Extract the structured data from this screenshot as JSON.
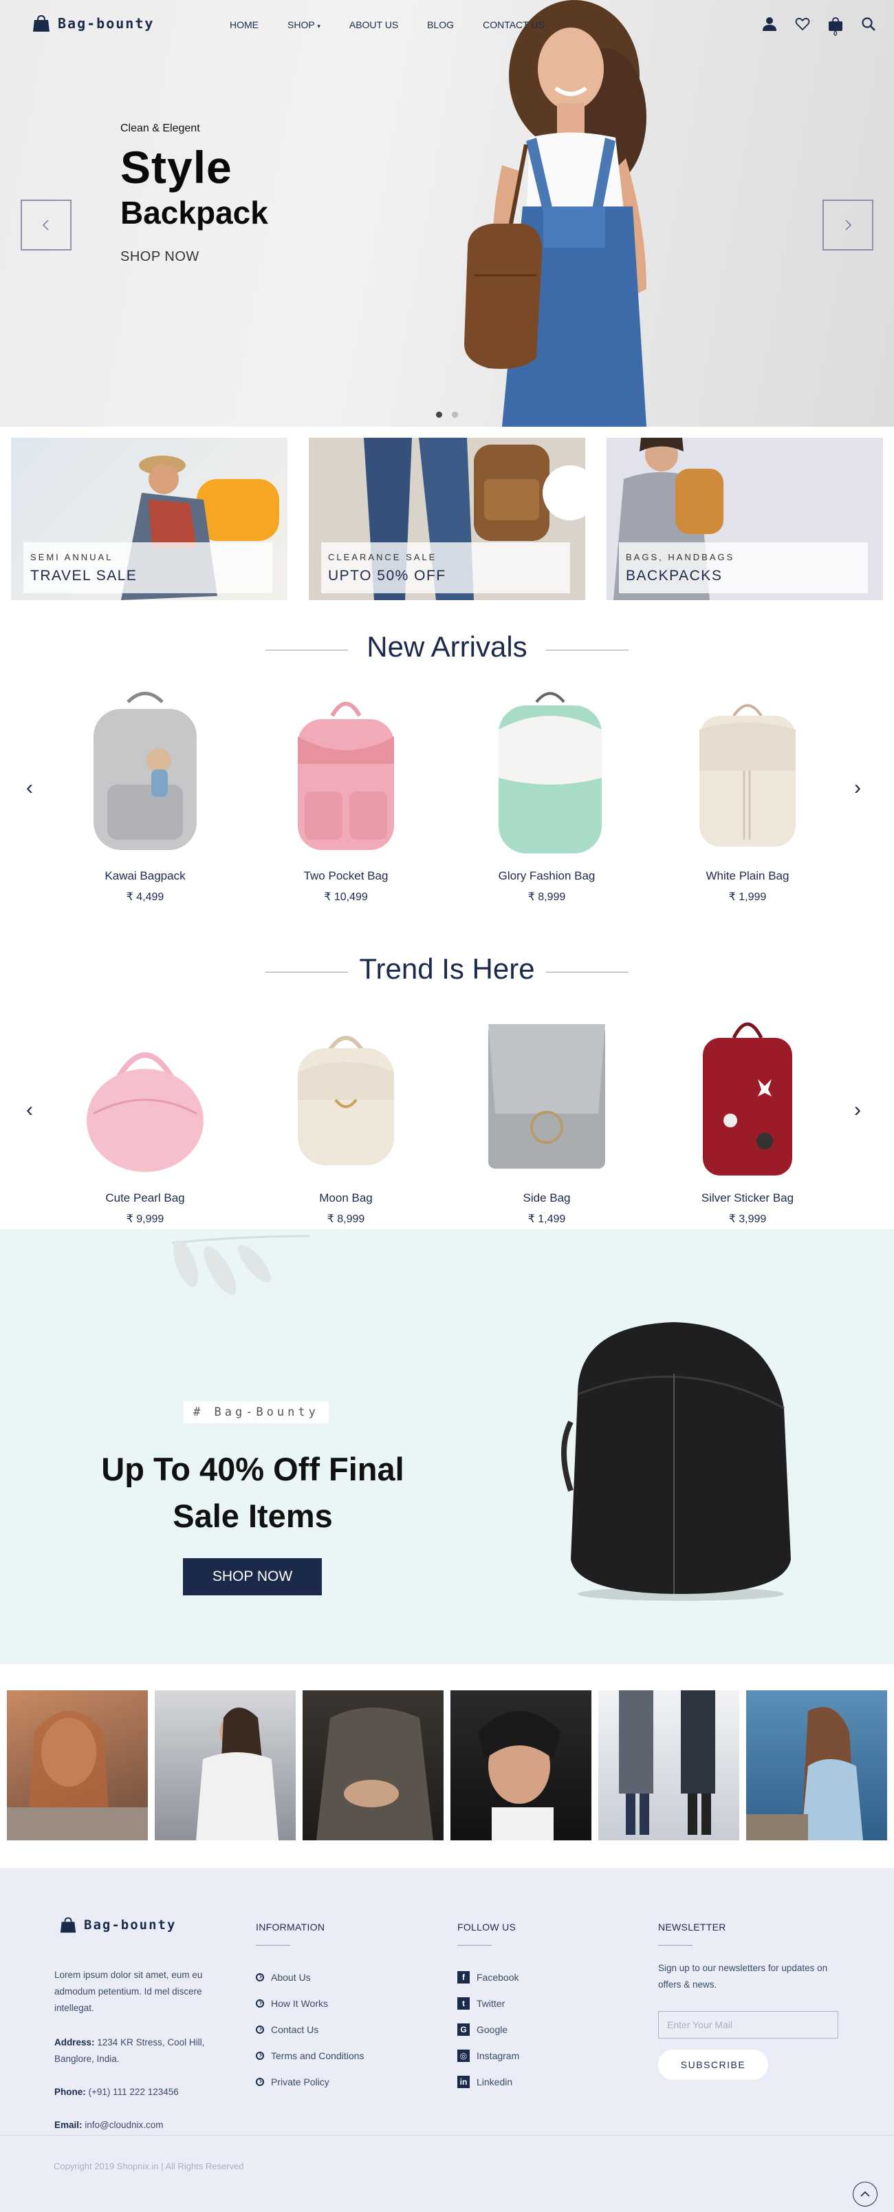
{
  "header": {
    "brand": "Bag-bounty",
    "nav": [
      "HOME",
      "SHOP",
      "ABOUT US",
      "BLOG",
      "CONTACT US"
    ],
    "cart_count": "0"
  },
  "hero": {
    "tagline": "Clean & Elegent",
    "title_line1": "Style",
    "title_line2": "Backpack",
    "cta": "SHOP NOW",
    "slide_index": 1,
    "slide_total": 2
  },
  "promos": [
    {
      "small": "SEMI ANNUAL",
      "big": "TRAVEL SALE"
    },
    {
      "small": "CLEARANCE SALE",
      "big": "UPTO 50% OFF"
    },
    {
      "small": "BAGS, HANDBAGS",
      "big": "BACKPACKS"
    }
  ],
  "new_arrivals": {
    "title": "New Arrivals",
    "products": [
      {
        "name": "Kawai Bagpack",
        "price": "₹ 4,499"
      },
      {
        "name": "Two Pocket Bag",
        "price": "₹ 10,499"
      },
      {
        "name": "Glory Fashion Bag",
        "price": "₹ 8,999"
      },
      {
        "name": "White Plain Bag",
        "price": "₹ 1,999"
      }
    ]
  },
  "trend": {
    "title": "Trend Is Here",
    "products": [
      {
        "name": "Cute Pearl Bag",
        "price": "₹ 9,999"
      },
      {
        "name": "Moon Bag",
        "price": "₹ 8,999"
      },
      {
        "name": "Side Bag",
        "price": "₹ 1,499"
      },
      {
        "name": "Silver Sticker Bag",
        "price": "₹ 3,999"
      }
    ]
  },
  "sale": {
    "tag": "# Bag-Bounty",
    "title": "Up To 40% Off Final Sale Items",
    "cta": "SHOP NOW"
  },
  "footer": {
    "brand": "Bag-bounty",
    "about": "Lorem ipsum dolor sit amet, eum eu admodum petentium. Id mel discere intellegat.",
    "address_label": "Address:",
    "address": "1234 KR Stress, Cool Hill, Banglore, India.",
    "phone_label": "Phone:",
    "phone": "(+91) 111 222 123456",
    "email_label": "Email:",
    "email": "info@cloudnix.com",
    "information_title": "INFORMATION",
    "information": [
      "About Us",
      "How It Works",
      "Contact Us",
      "Terms and Conditions",
      "Private Policy"
    ],
    "follow_title": "FOLLOW US",
    "follow": [
      {
        "label": "Facebook",
        "icon": "facebook-icon"
      },
      {
        "label": "Twitter",
        "icon": "twitter-icon"
      },
      {
        "label": "Google",
        "icon": "google-icon"
      },
      {
        "label": "Instagram",
        "icon": "instagram-icon"
      },
      {
        "label": "Linkedin",
        "icon": "linkedin-icon"
      }
    ],
    "newsletter_title": "NEWSLETTER",
    "newsletter_text": "Sign up to our newsletters for updates on offers & news.",
    "newsletter_placeholder": "Enter Your Mail",
    "subscribe": "SUBSCRIBE",
    "copyright": "Copyright 2019 Shopnix.in | All Rights Reserved"
  },
  "colors": {
    "primary": "#1b2a4a",
    "sale_bg": "#eaf6f6",
    "footer_bg": "#eaedf6"
  }
}
